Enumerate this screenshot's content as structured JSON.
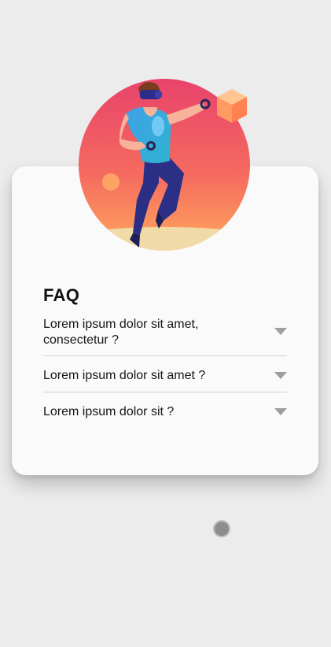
{
  "faq": {
    "title": "FAQ",
    "items": [
      {
        "question": "Lorem ipsum dolor sit amet, consectetur ?"
      },
      {
        "question": "Lorem ipsum dolor sit amet ?"
      },
      {
        "question": "Lorem ipsum dolor sit ?"
      }
    ]
  },
  "icons": {
    "expand": "chevron-down-icon",
    "illustration": "vr-person-illustration"
  },
  "colors": {
    "background": "#ececec",
    "card": "#fafafa",
    "arrow": "#9e9e9e",
    "divider": "#d2d2d2",
    "dot": "#8d8d8d",
    "gradient_top": "#e8436b",
    "gradient_bottom": "#ffa45c"
  }
}
